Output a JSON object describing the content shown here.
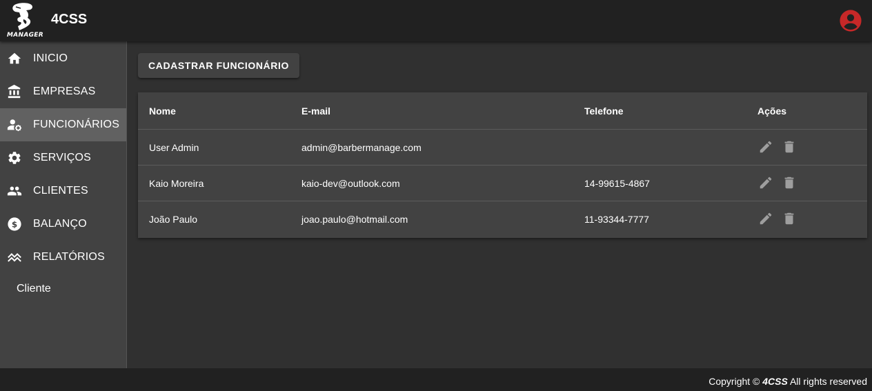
{
  "app": {
    "title": "4CSS",
    "logo_text": "MANAGER"
  },
  "sidebar": {
    "items": [
      {
        "label": "INICIO",
        "icon": "home-icon"
      },
      {
        "label": "EMPRESAS",
        "icon": "bank-icon"
      },
      {
        "label": "FUNCIONÁRIOS",
        "icon": "user-settings-icon",
        "active": true
      },
      {
        "label": "SERVIÇOS",
        "icon": "gear-icon"
      },
      {
        "label": "CLIENTES",
        "icon": "people-icon"
      },
      {
        "label": "BALANÇO",
        "icon": "dollar-icon"
      },
      {
        "label": "RELATÓRIOS",
        "icon": "trend-icon"
      }
    ],
    "extra_item": "Cliente"
  },
  "main": {
    "add_button_label": "CADASTRAR FUNCIONÁRIO",
    "table": {
      "headers": [
        "Nome",
        "E-mail",
        "Telefone",
        "Ações"
      ],
      "rows": [
        {
          "nome": "User Admin",
          "email": "admin@barbermanage.com",
          "telefone": ""
        },
        {
          "nome": "Kaio Moreira",
          "email": "kaio-dev@outlook.com",
          "telefone": "14-99615-4867"
        },
        {
          "nome": "João Paulo",
          "email": "joao.paulo@hotmail.com",
          "telefone": "11-93344-7777"
        }
      ],
      "actions": [
        "edit-icon",
        "delete-icon"
      ]
    }
  },
  "footer": {
    "prefix": "Copyright ©",
    "brand": "4CSS",
    "suffix": "All rights reserved"
  },
  "colors": {
    "appbar": "#212121",
    "sidebar": "#424242",
    "active_item": "#616161",
    "background": "#303030",
    "account_icon": "#c62828",
    "action_icon": "#9e9e9e"
  }
}
